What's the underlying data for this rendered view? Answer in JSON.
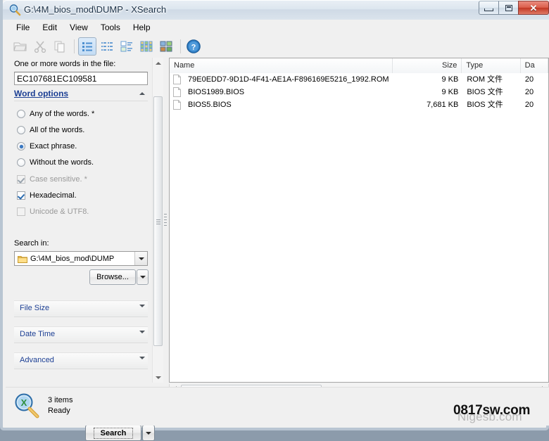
{
  "window": {
    "title": "G:\\4M_bios_mod\\DUMP - XSearch",
    "icon": "magnifier-icon",
    "controls": {
      "minimize": "minimize-button",
      "maximize": "maximize-button",
      "close": "close-button"
    }
  },
  "menubar": {
    "items": [
      {
        "label": "File"
      },
      {
        "label": "Edit"
      },
      {
        "label": "View"
      },
      {
        "label": "Tools"
      },
      {
        "label": "Help"
      }
    ]
  },
  "toolbar": {
    "buttons": [
      {
        "name": "open-folder-icon",
        "pressed": false,
        "enabled": false
      },
      {
        "name": "cut-icon",
        "pressed": false,
        "enabled": false
      },
      {
        "name": "copy-icon",
        "pressed": false,
        "enabled": false
      },
      {
        "name": "view-details-icon",
        "pressed": true,
        "enabled": true
      },
      {
        "name": "view-list-icon",
        "pressed": false,
        "enabled": true
      },
      {
        "name": "view-tiles-icon",
        "pressed": false,
        "enabled": true
      },
      {
        "name": "view-small-icons-icon",
        "pressed": false,
        "enabled": true
      },
      {
        "name": "view-large-icons-icon",
        "pressed": false,
        "enabled": true
      },
      {
        "name": "help-icon",
        "pressed": false,
        "enabled": true
      }
    ]
  },
  "left_panel": {
    "words_label": "One or more words in the file:",
    "words_value": "EC107681EC109581",
    "words_placeholder": "",
    "word_options": {
      "label": "Word options",
      "mnemonic": "W",
      "expanded": true
    },
    "options": [
      {
        "type": "radio",
        "label": "Any of the words. *",
        "checked": false,
        "enabled": true
      },
      {
        "type": "radio",
        "label": "All of the words.",
        "checked": false,
        "enabled": true
      },
      {
        "type": "radio",
        "label": "Exact phrase.",
        "checked": true,
        "enabled": true
      },
      {
        "type": "radio",
        "label": "Without the words.",
        "checked": false,
        "enabled": true
      },
      {
        "type": "checkbox",
        "label": "Case sensitive. *",
        "checked": true,
        "enabled": false
      },
      {
        "type": "checkbox",
        "label": "Hexadecimal.",
        "checked": true,
        "enabled": true
      },
      {
        "type": "checkbox",
        "label": "Unicode & UTF8.",
        "checked": false,
        "enabled": false
      }
    ],
    "search_in_label": "Search in:",
    "search_in_value": "G:\\4M_bios_mod\\DUMP",
    "browse_label": "Browse...",
    "browse_mnemonic": "B",
    "sections": [
      {
        "label": "File Size",
        "mnemonic": "z",
        "expanded": false
      },
      {
        "label": "Date Time",
        "mnemonic": "T",
        "expanded": false
      },
      {
        "label": "Advanced",
        "mnemonic": "A",
        "expanded": false
      }
    ],
    "search_button": {
      "label": "Search",
      "mnemonic": "S",
      "focused": true
    }
  },
  "file_list": {
    "columns": [
      {
        "label": "Name",
        "align": "left"
      },
      {
        "label": "Size",
        "align": "right"
      },
      {
        "label": "Type",
        "align": "left"
      },
      {
        "label": "Da",
        "align": "left"
      }
    ],
    "rows": [
      {
        "name": "79E0EDD7-9D1D-4F41-AE1A-F896169E5216_1992.ROM",
        "size": "9 KB",
        "type": "ROM 文件",
        "date": "20"
      },
      {
        "name": "BIOS1989.BIOS",
        "size": "9 KB",
        "type": "BIOS 文件",
        "date": "20"
      },
      {
        "name": "BIOS5.BIOS",
        "size": "7,681 KB",
        "type": "BIOS 文件",
        "date": "20"
      }
    ]
  },
  "status_bar": {
    "icon": "magnifier-icon",
    "items_text": "3 items",
    "state_text": "Ready"
  },
  "watermark": {
    "front": "0817sw.com",
    "back": "Nigesb.com"
  },
  "colors": {
    "link": "#1c3f94",
    "accent": "#3a78c2",
    "close_button": "#c23724",
    "window_bg": "#f0f0f0"
  }
}
